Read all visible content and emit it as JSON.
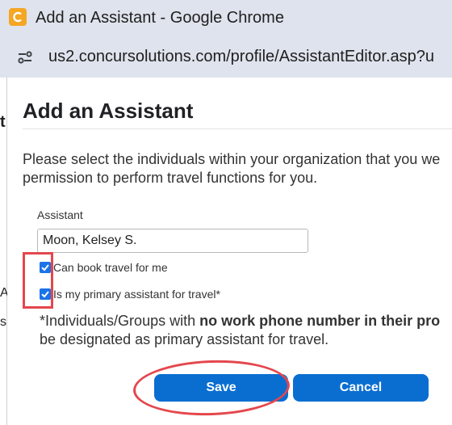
{
  "window": {
    "title": "Add an Assistant - Google Chrome",
    "url": "us2.concursolutions.com/profile/AssistantEditor.asp?u"
  },
  "background_page": {
    "glyph_1": "t",
    "glyph_2": "A",
    "glyph_3": "s"
  },
  "dialog": {
    "title": "Add an Assistant",
    "intro_line_1": "Please select the individuals within your organization that you we",
    "intro_line_2": "permission to perform travel functions for you.",
    "assistant_label": "Assistant",
    "assistant_value": "Moon, Kelsey S.",
    "checkbox_book_label": "Can book travel for me",
    "checkbox_book_checked": true,
    "checkbox_primary_label": "Is my primary assistant for travel*",
    "checkbox_primary_checked": true,
    "note_prefix": "*Individuals/Groups with ",
    "note_bold": "no work phone number in their pro",
    "note_line_2": "be designated as primary assistant for travel.",
    "save_label": "Save",
    "cancel_label": "Cancel"
  },
  "colors": {
    "button": "#0a6ed1",
    "checkbox": "#1a73e8",
    "annotation": "#e4474d",
    "chrome_frame": "#dfe3ed"
  }
}
